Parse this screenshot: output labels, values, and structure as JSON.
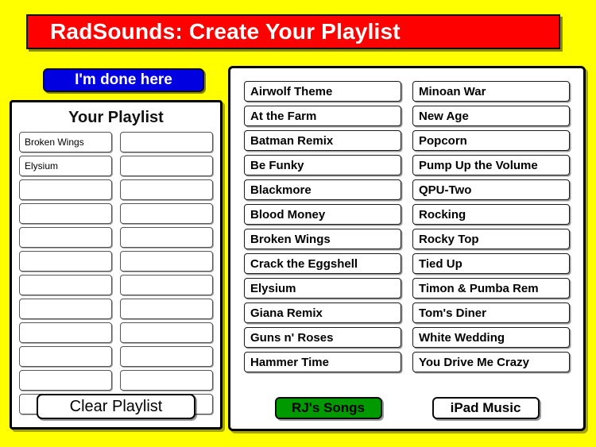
{
  "app": {
    "title": "RadSounds: Create Your Playlist",
    "background_color": "#FFFF00",
    "banner_color": "#FF0000",
    "banner_text_color": "#FFFFFF"
  },
  "done_button": {
    "label": "I'm done here",
    "background_color": "#0000E0",
    "text_color": "#FFFFFF"
  },
  "playlist": {
    "heading": "Your Playlist",
    "clear_button_label": "Clear Playlist",
    "slots": [
      "Broken Wings",
      "",
      "Elysium",
      "",
      "",
      "",
      "",
      "",
      "",
      "",
      "",
      "",
      "",
      "",
      "",
      "",
      "",
      "",
      "",
      "",
      "",
      "",
      "",
      ""
    ]
  },
  "songs": {
    "items": [
      "Airwolf Theme",
      "Minoan War",
      "At the Farm",
      "New Age",
      "Batman Remix",
      "Popcorn",
      "Be Funky",
      "Pump Up the Volume",
      "Blackmore",
      "QPU-Two",
      "Blood Money",
      "Rocking",
      "Broken Wings",
      "Rocky Top",
      "Crack the Eggshell",
      "Tied Up",
      "Elysium",
      "Timon & Pumba Rem",
      "Giana Remix",
      "Tom's Diner",
      "Guns n' Roses",
      "White Wedding",
      "Hammer Time",
      "You Drive Me Crazy"
    ]
  },
  "sources": {
    "rj_songs_label": "RJ's Songs",
    "rj_songs_color": "#009900",
    "ipad_music_label": "iPad Music",
    "ipad_music_color": "#FFFFFF"
  }
}
